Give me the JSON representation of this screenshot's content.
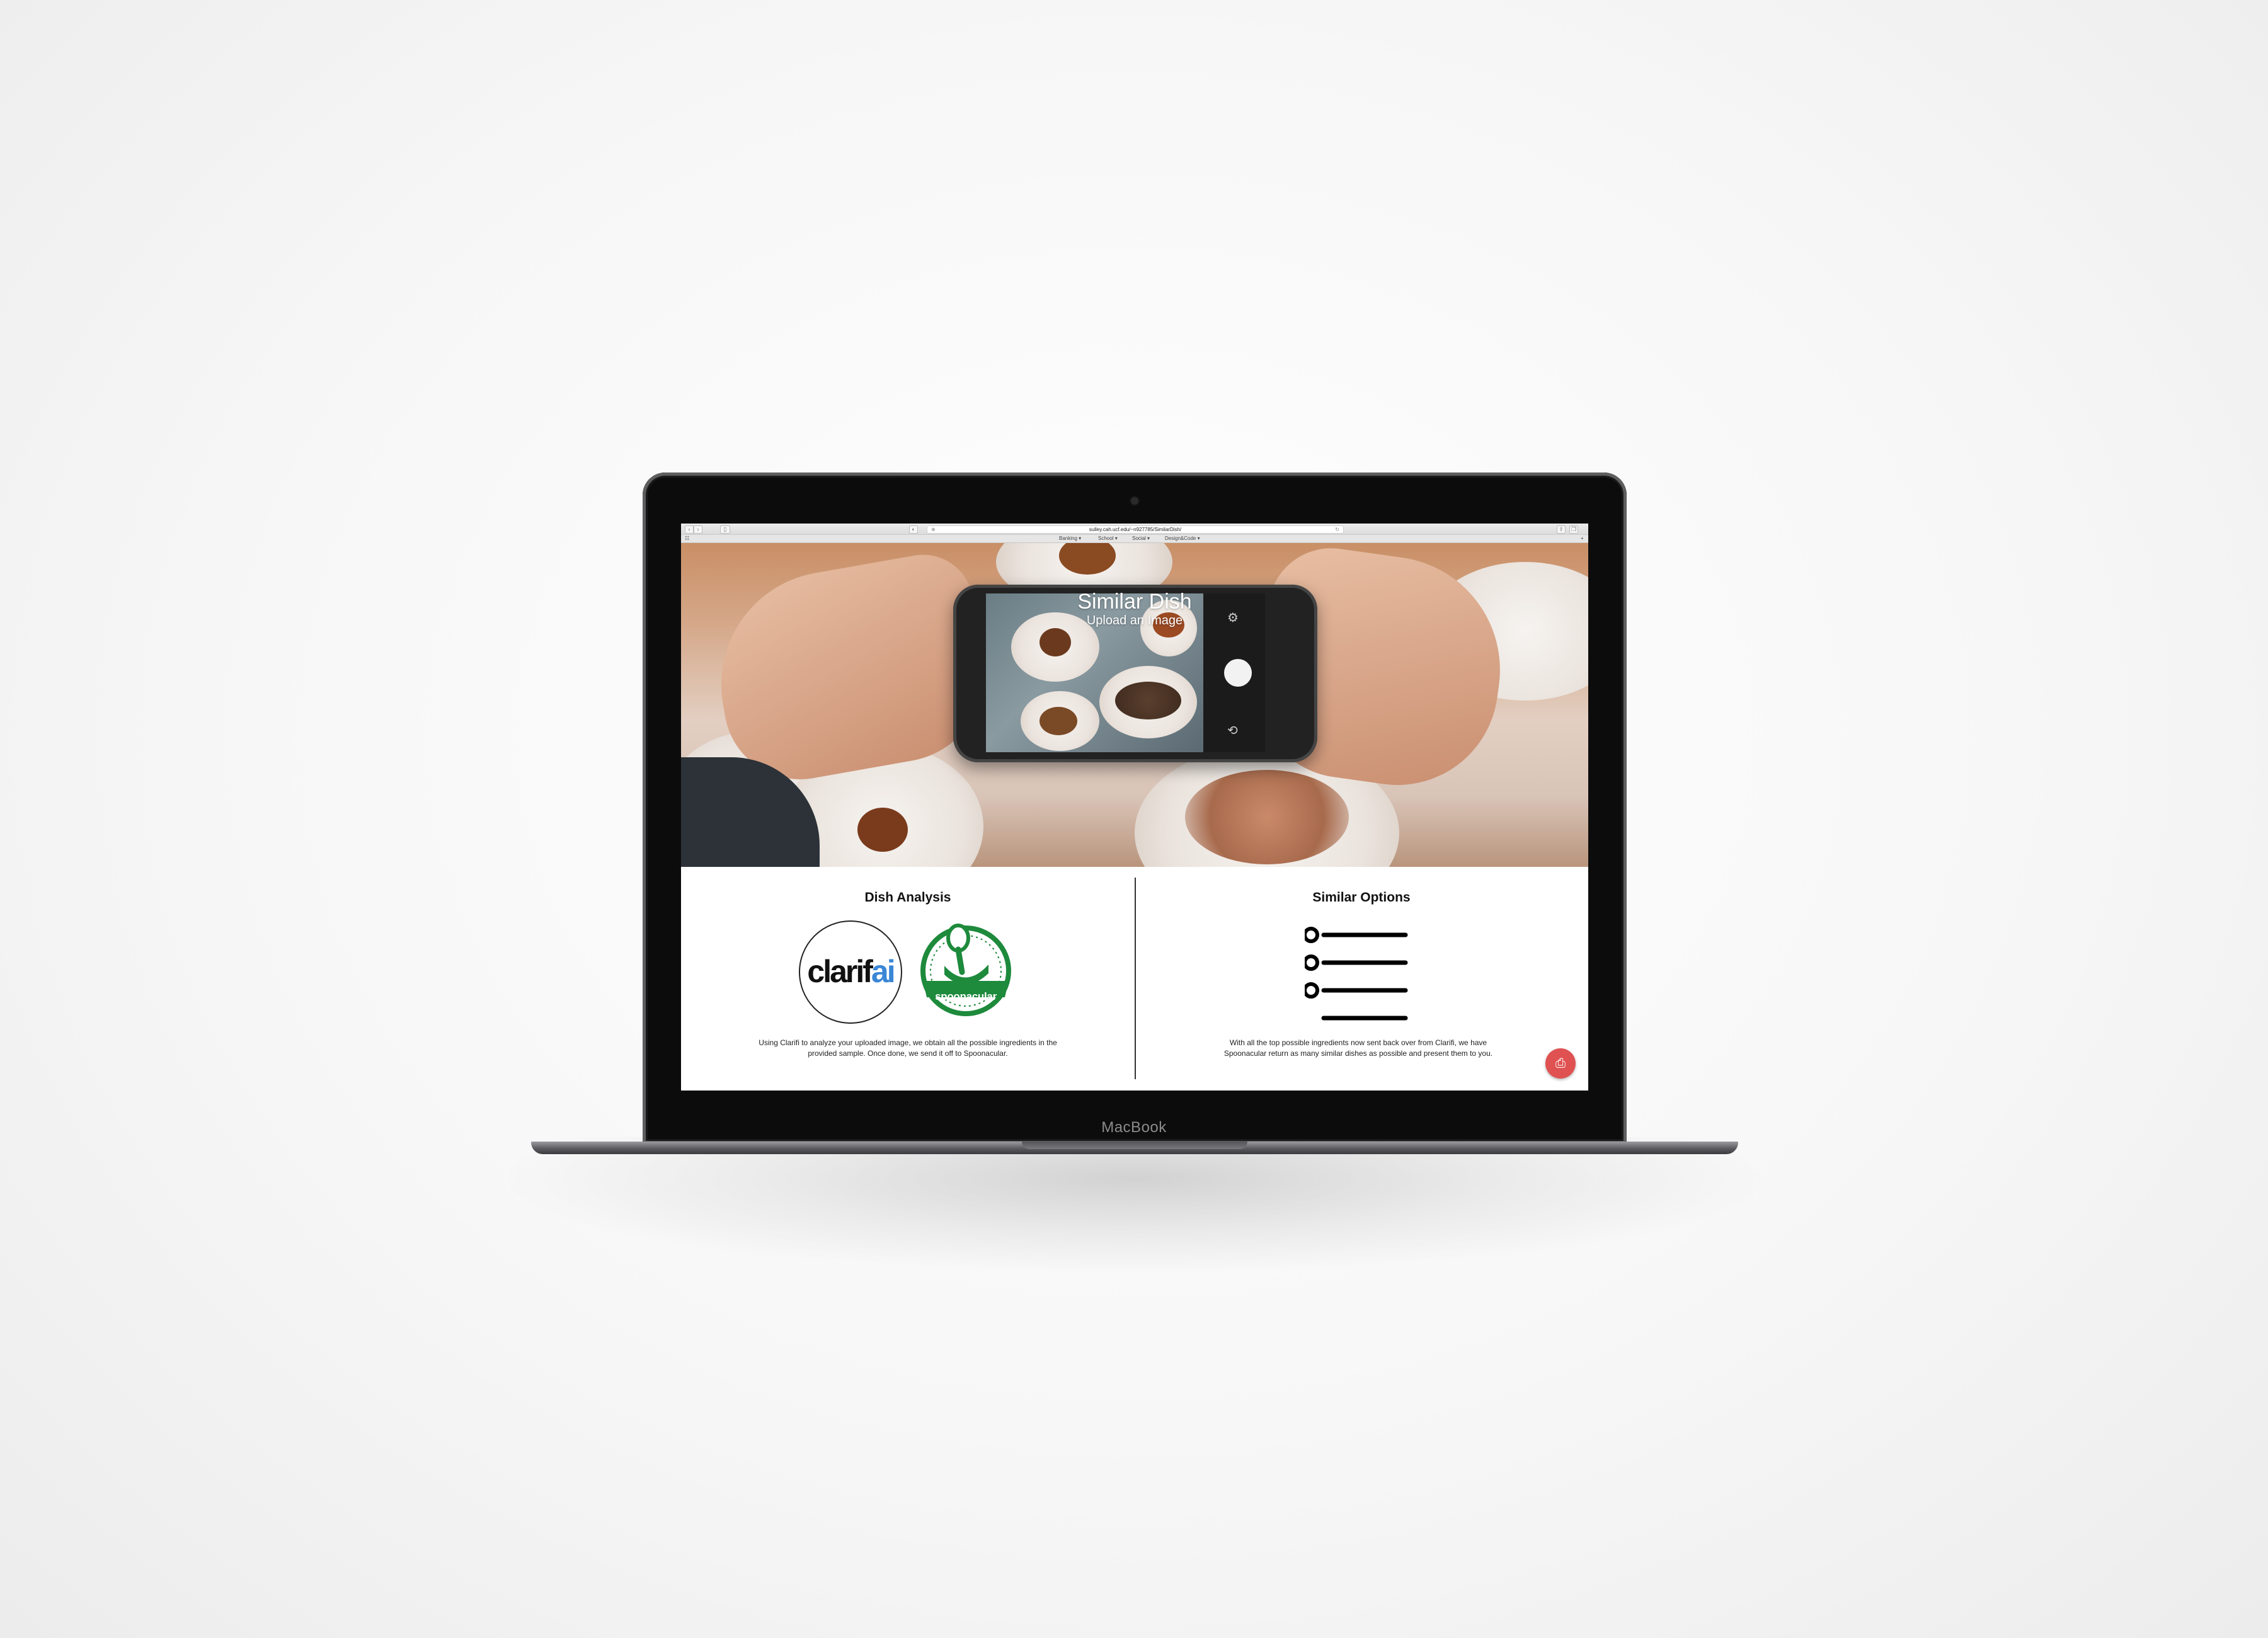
{
  "device": {
    "brand_label": "MacBook"
  },
  "browser": {
    "url": "sulley.cah.ucf.edu/~n927785/SimilarDish/",
    "bookmarks": [
      "Banking",
      "School",
      "Social",
      "Design&Code"
    ]
  },
  "hero": {
    "title": "Similar Dish",
    "subtitle": "Upload an Image"
  },
  "sections": {
    "analysis": {
      "title": "Dish Analysis",
      "logo_clarifai_text": "clarif",
      "logo_clarifai_accent": "ai",
      "logo_spoonacular_text": "spoonacular",
      "description": "Using Clarifi to analyze your uploaded image, we obtain all the possible ingredients in the provided sample. Once done, we send it off to Spoonacular."
    },
    "options": {
      "title": "Similar Options",
      "icon": "list-icon",
      "description": "With all the top possible ingredients now sent back over from Clarifi, we have Spoonacular return as many similar dishes as possible and present them to you."
    }
  },
  "fab": {
    "icon": "upload-file-icon",
    "color": "#e05151"
  },
  "colors": {
    "clarifai_accent": "#3a86d6",
    "spoonacular_green": "#1e8a3c"
  }
}
